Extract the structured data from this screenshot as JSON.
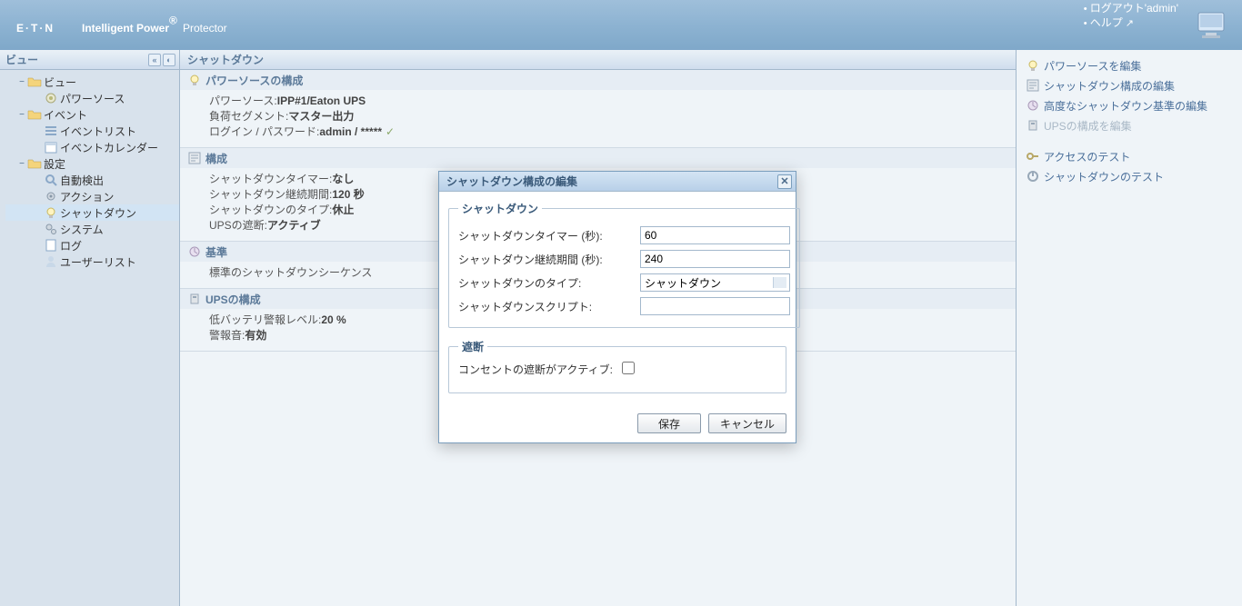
{
  "header": {
    "logo_text": "E·T·N",
    "app_title_1": "Intelligent Power",
    "app_title_2": "Protector",
    "logout": "ログアウト'admin'",
    "help": "ヘルプ"
  },
  "nav": {
    "title": "ビュー",
    "items": [
      {
        "label": "ビュー",
        "depth": 0,
        "icon": "folder",
        "toggle": "−"
      },
      {
        "label": "パワーソース",
        "depth": 1,
        "icon": "power"
      },
      {
        "label": "イベント",
        "depth": 0,
        "icon": "folder",
        "toggle": "−"
      },
      {
        "label": "イベントリスト",
        "depth": 1,
        "icon": "list"
      },
      {
        "label": "イベントカレンダー",
        "depth": 1,
        "icon": "calendar"
      },
      {
        "label": "設定",
        "depth": 0,
        "icon": "folder",
        "toggle": "−"
      },
      {
        "label": "自動検出",
        "depth": 1,
        "icon": "search"
      },
      {
        "label": "アクション",
        "depth": 1,
        "icon": "gear"
      },
      {
        "label": "シャットダウン",
        "depth": 1,
        "icon": "bulb",
        "selected": true
      },
      {
        "label": "システム",
        "depth": 1,
        "icon": "gears"
      },
      {
        "label": "ログ",
        "depth": 1,
        "icon": "page"
      },
      {
        "label": "ユーザーリスト",
        "depth": 1,
        "icon": "user"
      }
    ]
  },
  "content": {
    "title": "シャットダウン",
    "sections": [
      {
        "icon": "bulb",
        "title": "パワーソースの構成",
        "rows": [
          {
            "k": "パワーソース: ",
            "v": "IPP#1/Eaton UPS"
          },
          {
            "k": "負荷セグメント: ",
            "v": "マスター出力"
          },
          {
            "k": "ログイン / パスワード: ",
            "v": "admin / *****",
            "check": true
          }
        ]
      },
      {
        "icon": "config",
        "title": "構成",
        "rows": [
          {
            "k": "シャットダウンタイマー: ",
            "v": "なし"
          },
          {
            "k": "シャットダウン継続期間: ",
            "v": "120 秒"
          },
          {
            "k": "シャットダウンのタイプ: ",
            "v": "休止"
          },
          {
            "k": "UPSの遮断: ",
            "v": "アクティブ"
          }
        ]
      },
      {
        "icon": "criteria",
        "title": "基準",
        "rows": [
          {
            "k": "標準のシャットダウンシーケンス",
            "v": ""
          }
        ]
      },
      {
        "icon": "ups",
        "title": "UPSの構成",
        "rows": [
          {
            "k": "低バッテリ警報レベル: ",
            "v": "20 %"
          },
          {
            "k": "警報音: ",
            "v": "有効"
          }
        ]
      }
    ]
  },
  "actions": {
    "group1": [
      {
        "label": "パワーソースを編集",
        "icon": "bulb",
        "disabled": false
      },
      {
        "label": "シャットダウン構成の編集",
        "icon": "config",
        "disabled": false
      },
      {
        "label": "高度なシャットダウン基準の編集",
        "icon": "criteria",
        "disabled": false
      },
      {
        "label": "UPSの構成を編集",
        "icon": "ups",
        "disabled": true
      }
    ],
    "group2": [
      {
        "label": "アクセスのテスト",
        "icon": "key",
        "disabled": false
      },
      {
        "label": "シャットダウンのテスト",
        "icon": "shutdown",
        "disabled": false
      }
    ]
  },
  "modal": {
    "title": "シャットダウン構成の編集",
    "fieldset1_legend": "シャットダウン",
    "fieldset2_legend": "遮断",
    "rows": {
      "timer_label": "シャットダウンタイマー (秒):",
      "timer_value": "60",
      "duration_label": "シャットダウン継続期間 (秒):",
      "duration_value": "240",
      "type_label": "シャットダウンのタイプ:",
      "type_value": "シャットダウン",
      "script_label": "シャットダウンスクリプト:",
      "script_value": "",
      "outlet_label": "コンセントの遮断がアクティブ:"
    },
    "save": "保存",
    "cancel": "キャンセル"
  }
}
